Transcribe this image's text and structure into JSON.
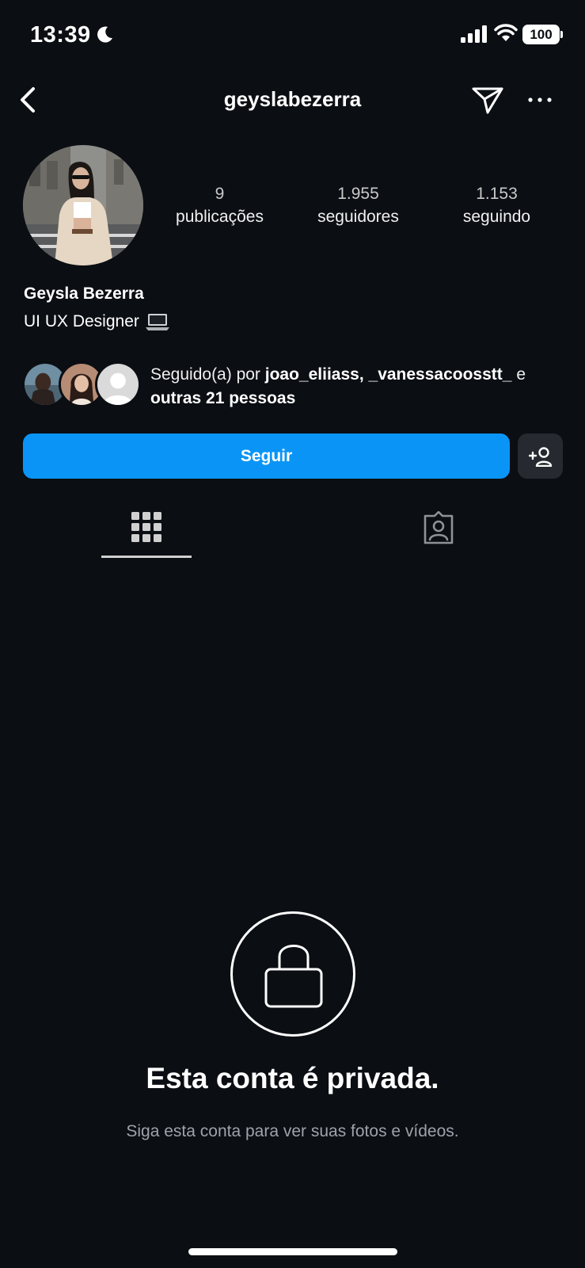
{
  "status_bar": {
    "time": "13:39",
    "battery": "100"
  },
  "header": {
    "username": "geyslabezerra"
  },
  "profile": {
    "stats": [
      {
        "value": "9",
        "label": "publicações"
      },
      {
        "value": "1.955",
        "label": "seguidores"
      },
      {
        "value": "1.153",
        "label": "seguindo"
      }
    ],
    "name": "Geysla Bezerra",
    "bio": "UI UX Designer"
  },
  "followed_by": {
    "prefix": "Seguido(a) por",
    "user1": "joao_eliiass,",
    "user2": "_vanessacoosstt_",
    "connector": "e",
    "others": "outras 21 pessoas"
  },
  "actions": {
    "follow_label": "Seguir"
  },
  "private": {
    "title": "Esta conta é privada.",
    "subtitle": "Siga esta conta para ver suas fotos e vídeos."
  },
  "colors": {
    "accent": "#0a95f6",
    "background": "#0b0e13",
    "secondary_button": "#262a30"
  }
}
